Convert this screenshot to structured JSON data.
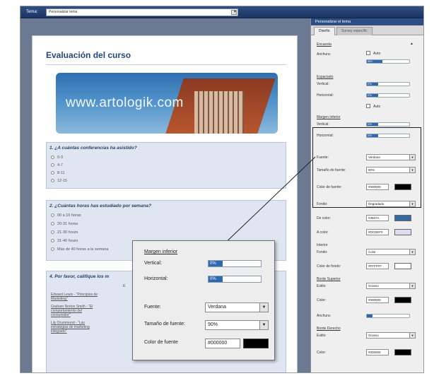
{
  "topbar": {
    "label": "Tema:",
    "selected": "Personalizar tema"
  },
  "document": {
    "title": "Evaluación del curso",
    "banner_url": "www.artologik.com",
    "q1": {
      "title": "1. ¿A cuántas conferencias ha asistido?",
      "options": [
        "0-3",
        "4-7",
        "8-11",
        "12-15"
      ]
    },
    "q2": {
      "title": "2. ¿Cuántas horas has estudiado por semana?",
      "options": [
        "00 a 10 horas",
        "20-31 horas",
        "21-30 hours",
        "31-40 hours",
        "Más de 40 horas a la semana"
      ]
    },
    "q3": {
      "title": "4. Por favor, califique los m",
      "extra": "E",
      "items": [
        "Edward Lewis - \"Principios de Marketing\"",
        "Graham Norton Smith - \"El comportamiento del consumidor\"",
        "Lily Drummond - \"Las estrategias de marketing integrado\""
      ]
    }
  },
  "panel": {
    "header": "Personalizar el tema",
    "tabs": [
      "Diseño",
      "Survey específic"
    ],
    "sec_encuesta": "Encuesta",
    "collapse": "▲",
    "anchura": "Anchura:",
    "auto": "Auto",
    "anchura_value": "560",
    "espaciado": "Espaciado",
    "vertical": "Vertical:",
    "horizontal": "Horizontal:",
    "esp_v": "0%",
    "esp_h": "0%",
    "auto2": "Auto",
    "margen": "Margen inferior",
    "mar_v": "0%",
    "mar_h": "0%",
    "fuente": "Fuente:",
    "fuente_val": "Verdana",
    "tamano": "Tamaño de fuente:",
    "tamano_val": "90%",
    "color_fuente": "Color de fuente:",
    "color_fuente_val": "#000000",
    "fondo": "Fondo:",
    "fondo_val": "Degradado",
    "de_color": "De color:",
    "de_color_val": "#3567A",
    "a_color": "A color:",
    "a_color_val": "#DCDEF0",
    "interior": "Interior",
    "fondo2": "Fondo:",
    "fondo2_val": "Color",
    "color_fondo": "Color de fondo:",
    "color_fondo_val": "#FFFFFF",
    "borde_sup": "Borde Superior",
    "estilo": "Estilo:",
    "estilo_val": "Grueso",
    "color": "Color:",
    "color_val": "#000000",
    "anchura2": "Anchura:",
    "borde_der": "Borde Derecho",
    "estilo2": "Estilo:",
    "estilo2_val": "Grueso",
    "color2": "Color:",
    "color2_val": "#000000",
    "arrow": "▼"
  },
  "zoom": {
    "margen": "Margen inferior",
    "vertical": "Vertical:",
    "v_val": "0%",
    "horizontal": "Horizontal:",
    "h_val": "0%",
    "fuente": "Fuente:",
    "fuente_val": "Verdana",
    "tamano": "Tamaño de fuente:",
    "tamano_val": "90%",
    "color_fuente": "Color de fuente",
    "color_val": "#000000",
    "arrow": "▼"
  },
  "colors": {
    "accent": "#2f67b1",
    "header": "#2d4f86",
    "swatch_blue": "#3567A0",
    "swatch_light": "#DCDEF0"
  }
}
